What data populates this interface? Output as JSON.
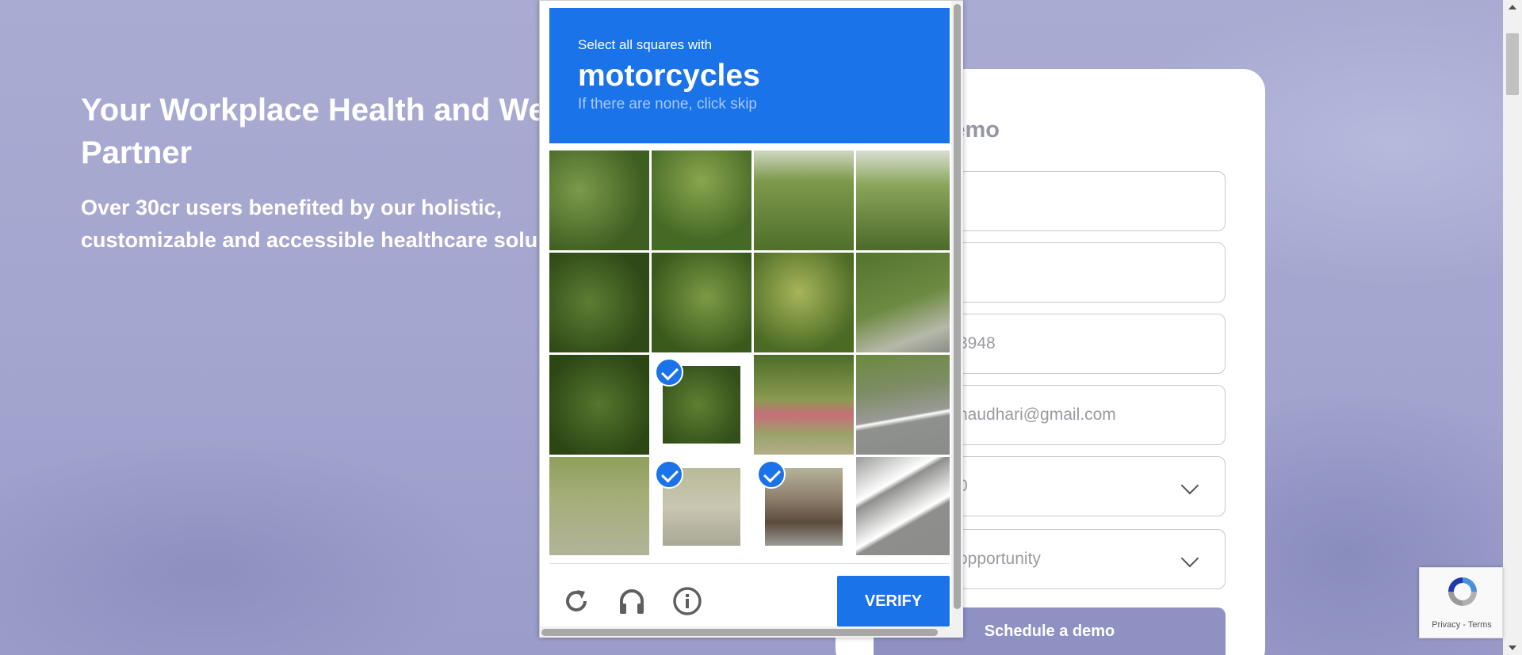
{
  "hero": {
    "title": "Your Workplace Health and We\nPartner",
    "subtitle": "Over 30cr users benefited by our holistic,\ncustomizable and accessible healthcare solu"
  },
  "form": {
    "title": "e a Demo",
    "fields": [
      {
        "value": ""
      },
      {
        "value": ""
      },
      {
        "value": "3948"
      },
      {
        "value": "haudhari@gmail.com"
      },
      {
        "value": "0",
        "type": "select"
      },
      {
        "value": "opportunity",
        "type": "select"
      }
    ],
    "submit_label": "Schedule a demo"
  },
  "captcha": {
    "instruction": "Select all squares with",
    "keyword": "motorcycles",
    "hint": "If there are none, click skip",
    "tiles": [
      {
        "selected": false
      },
      {
        "selected": false
      },
      {
        "selected": false
      },
      {
        "selected": false
      },
      {
        "selected": false
      },
      {
        "selected": false
      },
      {
        "selected": false
      },
      {
        "selected": false
      },
      {
        "selected": false
      },
      {
        "selected": true
      },
      {
        "selected": false
      },
      {
        "selected": false
      },
      {
        "selected": false
      },
      {
        "selected": true
      },
      {
        "selected": true
      },
      {
        "selected": false
      }
    ],
    "verify_label": "VERIFY",
    "icons": [
      "reload-icon",
      "audio-icon",
      "info-icon"
    ]
  },
  "recaptcha_badge": {
    "links": "Privacy - Terms"
  },
  "colors": {
    "accent": "#1a73e8",
    "schedule_button": "#8f91c3"
  }
}
